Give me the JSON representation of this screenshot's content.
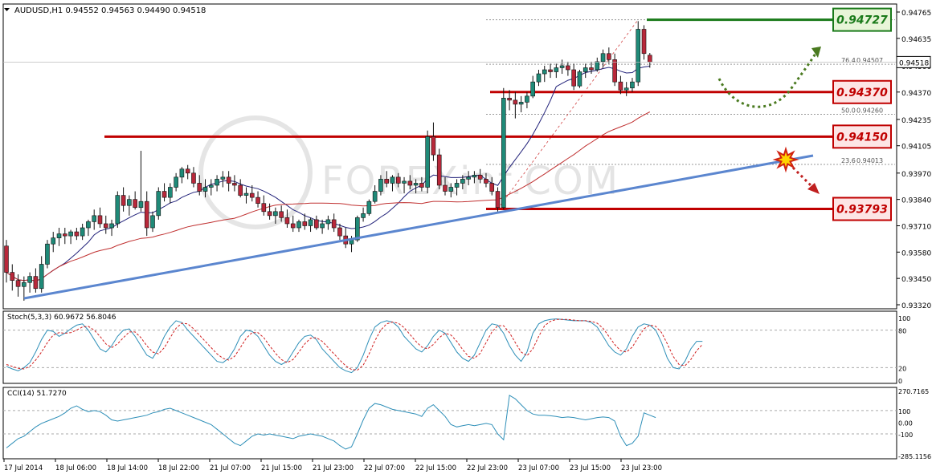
{
  "chart_data": [
    {
      "type": "candlestick",
      "symbol_header": "AUDUSD,H1  0.94552 0.94563 0.94490 0.94518",
      "y_ticks": [
        "0.94765",
        "0.94635",
        "0.94500",
        "0.94370",
        "0.94235",
        "0.94105",
        "0.93970",
        "0.93840",
        "0.93710",
        "0.93580",
        "0.93450",
        "0.93320"
      ],
      "ylim": [
        0.9332,
        0.94765
      ],
      "current_price_label": "0.94518",
      "levels": [
        {
          "label": "0.94727",
          "value": 0.94727,
          "color": "#1a7a1a"
        },
        {
          "label": "0.94370",
          "value": 0.9437,
          "color": "#c00000"
        },
        {
          "label": "0.94150",
          "value": 0.9415,
          "color": "#c00000"
        },
        {
          "label": "0.93793",
          "value": 0.93793,
          "color": "#c00000"
        }
      ],
      "fib_labels": [
        {
          "pct": "76.4",
          "price": "0.94507"
        },
        {
          "pct": "50.0",
          "price": "0.94260"
        },
        {
          "pct": "23.6",
          "price": "0.94013"
        }
      ],
      "x_labels": [
        "17 Jul 2014",
        "18 Jul 06:00",
        "18 Jul 14:00",
        "18 Jul 22:00",
        "21 Jul 07:00",
        "21 Jul 15:00",
        "21 Jul 23:00",
        "22 Jul 07:00",
        "22 Jul 15:00",
        "22 Jul 23:00",
        "23 Jul 07:00",
        "23 Jul 15:00",
        "23 Jul 23:00"
      ],
      "watermark": "FOREXinf.COM",
      "colors": {
        "bull": "#1f8a78",
        "bear": "#b8283a",
        "ma_fast": "#22227a",
        "ma_slow": "#c03030",
        "trendline": "#5b86cf"
      },
      "candles": [
        [
          0.9361,
          0.9364,
          0.9343,
          0.9348
        ],
        [
          0.9348,
          0.9352,
          0.9339,
          0.9344
        ],
        [
          0.9344,
          0.9347,
          0.9336,
          0.9341
        ],
        [
          0.9341,
          0.9346,
          0.9334,
          0.9343
        ],
        [
          0.9343,
          0.9348,
          0.9338,
          0.9346
        ],
        [
          0.9346,
          0.935,
          0.9338,
          0.934
        ],
        [
          0.934,
          0.9356,
          0.9338,
          0.9352
        ],
        [
          0.9352,
          0.9364,
          0.935,
          0.9362
        ],
        [
          0.9362,
          0.9368,
          0.9358,
          0.9365
        ],
        [
          0.9365,
          0.937,
          0.9361,
          0.9367
        ],
        [
          0.9367,
          0.937,
          0.9362,
          0.9366
        ],
        [
          0.9366,
          0.9369,
          0.9362,
          0.9368
        ],
        [
          0.9368,
          0.937,
          0.9364,
          0.9366
        ],
        [
          0.9366,
          0.9372,
          0.9364,
          0.937
        ],
        [
          0.937,
          0.9374,
          0.9366,
          0.9373
        ],
        [
          0.9373,
          0.9379,
          0.9369,
          0.9376
        ],
        [
          0.9376,
          0.938,
          0.937,
          0.9372
        ],
        [
          0.9372,
          0.9376,
          0.9367,
          0.937
        ],
        [
          0.937,
          0.9374,
          0.9366,
          0.9372
        ],
        [
          0.9372,
          0.9388,
          0.937,
          0.9386
        ],
        [
          0.9386,
          0.939,
          0.9378,
          0.9381
        ],
        [
          0.9381,
          0.9386,
          0.9376,
          0.9384
        ],
        [
          0.9384,
          0.9388,
          0.9379,
          0.938
        ],
        [
          0.938,
          0.9408,
          0.9378,
          0.9383
        ],
        [
          0.9383,
          0.9388,
          0.9366,
          0.937
        ],
        [
          0.937,
          0.9378,
          0.9368,
          0.9376
        ],
        [
          0.9376,
          0.939,
          0.9374,
          0.9388
        ],
        [
          0.9388,
          0.9392,
          0.9383,
          0.9385
        ],
        [
          0.9385,
          0.9392,
          0.9382,
          0.939
        ],
        [
          0.939,
          0.9397,
          0.9388,
          0.9395
        ],
        [
          0.9395,
          0.94,
          0.9392,
          0.9399
        ],
        [
          0.9399,
          0.9401,
          0.9394,
          0.9397
        ],
        [
          0.9397,
          0.94,
          0.939,
          0.9392
        ],
        [
          0.9392,
          0.9396,
          0.9386,
          0.9388
        ],
        [
          0.9388,
          0.9394,
          0.9385,
          0.939
        ],
        [
          0.939,
          0.9394,
          0.9386,
          0.9391
        ],
        [
          0.9391,
          0.9396,
          0.9388,
          0.9394
        ],
        [
          0.9394,
          0.9398,
          0.939,
          0.9395
        ],
        [
          0.9395,
          0.9398,
          0.9388,
          0.9392
        ],
        [
          0.9392,
          0.9396,
          0.9388,
          0.9391
        ],
        [
          0.9391,
          0.9394,
          0.9385,
          0.9386
        ],
        [
          0.9386,
          0.939,
          0.9382,
          0.9387
        ],
        [
          0.9387,
          0.9391,
          0.9383,
          0.9385
        ],
        [
          0.9385,
          0.9388,
          0.938,
          0.9382
        ],
        [
          0.9382,
          0.9386,
          0.9376,
          0.9378
        ],
        [
          0.9378,
          0.9382,
          0.9374,
          0.9376
        ],
        [
          0.9376,
          0.938,
          0.9372,
          0.9378
        ],
        [
          0.9378,
          0.9381,
          0.9373,
          0.9375
        ],
        [
          0.9375,
          0.9379,
          0.937,
          0.9372
        ],
        [
          0.9372,
          0.9376,
          0.9368,
          0.937
        ],
        [
          0.937,
          0.9374,
          0.9368,
          0.9373
        ],
        [
          0.9373,
          0.9377,
          0.9369,
          0.9371
        ],
        [
          0.9371,
          0.9375,
          0.9368,
          0.9374
        ],
        [
          0.9374,
          0.9376,
          0.9369,
          0.937
        ],
        [
          0.937,
          0.9374,
          0.9367,
          0.9372
        ],
        [
          0.9372,
          0.9376,
          0.9369,
          0.9374
        ],
        [
          0.9374,
          0.9377,
          0.9368,
          0.937
        ],
        [
          0.937,
          0.9372,
          0.9364,
          0.9366
        ],
        [
          0.9366,
          0.937,
          0.936,
          0.9362
        ],
        [
          0.9362,
          0.9366,
          0.9358,
          0.9364
        ],
        [
          0.9364,
          0.9376,
          0.9363,
          0.9375
        ],
        [
          0.9375,
          0.938,
          0.9373,
          0.9377
        ],
        [
          0.9377,
          0.9384,
          0.9376,
          0.9383
        ],
        [
          0.9383,
          0.9391,
          0.9382,
          0.9388
        ],
        [
          0.9388,
          0.9396,
          0.9386,
          0.9394
        ],
        [
          0.9394,
          0.9398,
          0.939,
          0.9392
        ],
        [
          0.9392,
          0.9396,
          0.9388,
          0.9395
        ],
        [
          0.9395,
          0.9397,
          0.939,
          0.9392
        ],
        [
          0.9392,
          0.9395,
          0.9387,
          0.9393
        ],
        [
          0.9393,
          0.9396,
          0.9389,
          0.9391
        ],
        [
          0.9391,
          0.9394,
          0.9387,
          0.9392
        ],
        [
          0.9392,
          0.9395,
          0.9388,
          0.939
        ],
        [
          0.939,
          0.9418,
          0.9387,
          0.9415
        ],
        [
          0.9415,
          0.9422,
          0.9403,
          0.9406
        ],
        [
          0.9406,
          0.9409,
          0.9389,
          0.9391
        ],
        [
          0.9391,
          0.9395,
          0.9386,
          0.9388
        ],
        [
          0.9388,
          0.9392,
          0.9385,
          0.939
        ],
        [
          0.939,
          0.9394,
          0.9386,
          0.9392
        ],
        [
          0.9392,
          0.9396,
          0.9389,
          0.9394
        ],
        [
          0.9394,
          0.9398,
          0.9391,
          0.9395
        ],
        [
          0.9395,
          0.9398,
          0.9392,
          0.9396
        ],
        [
          0.9396,
          0.9399,
          0.9392,
          0.9394
        ],
        [
          0.9394,
          0.9397,
          0.939,
          0.9392
        ],
        [
          0.9392,
          0.9395,
          0.9386,
          0.9388
        ],
        [
          0.9388,
          0.939,
          0.9378,
          0.938
        ],
        [
          0.938,
          0.9439,
          0.9379,
          0.9434
        ],
        [
          0.9434,
          0.9438,
          0.9428,
          0.9433
        ],
        [
          0.9433,
          0.9437,
          0.9424,
          0.9431
        ],
        [
          0.9431,
          0.9435,
          0.9427,
          0.9432
        ],
        [
          0.9432,
          0.9437,
          0.9429,
          0.9435
        ],
        [
          0.9435,
          0.9445,
          0.9434,
          0.9442
        ],
        [
          0.9442,
          0.9448,
          0.944,
          0.9446
        ],
        [
          0.9446,
          0.945,
          0.9442,
          0.9448
        ],
        [
          0.9448,
          0.9451,
          0.9444,
          0.9447
        ],
        [
          0.9447,
          0.9451,
          0.9444,
          0.9449
        ],
        [
          0.9449,
          0.9453,
          0.9446,
          0.945
        ],
        [
          0.945,
          0.9452,
          0.9445,
          0.9448
        ],
        [
          0.9448,
          0.9451,
          0.9438,
          0.944
        ],
        [
          0.944,
          0.9448,
          0.9439,
          0.9447
        ],
        [
          0.9447,
          0.9451,
          0.9444,
          0.9449
        ],
        [
          0.9449,
          0.9452,
          0.9446,
          0.9448
        ],
        [
          0.9448,
          0.9454,
          0.9447,
          0.9452
        ],
        [
          0.9452,
          0.9458,
          0.9449,
          0.9456
        ],
        [
          0.9456,
          0.9459,
          0.9451,
          0.9453
        ],
        [
          0.9453,
          0.9456,
          0.944,
          0.9442
        ],
        [
          0.9442,
          0.9445,
          0.9436,
          0.9438
        ],
        [
          0.9438,
          0.9442,
          0.9435,
          0.9439
        ],
        [
          0.9439,
          0.9444,
          0.9437,
          0.9442
        ],
        [
          0.9442,
          0.9472,
          0.944,
          0.9468
        ],
        [
          0.9468,
          0.947,
          0.9453,
          0.9456
        ],
        [
          0.94552,
          0.94563,
          0.9449,
          0.94518
        ]
      ],
      "stoch_header": "Stoch(5,3,3) 60.9672 56.8046",
      "stoch_ticks": [
        "100",
        "80",
        "20",
        "0"
      ],
      "stoch_main": [
        22,
        18,
        15,
        20,
        28,
        45,
        65,
        80,
        78,
        70,
        75,
        82,
        88,
        90,
        80,
        65,
        50,
        45,
        55,
        70,
        80,
        82,
        70,
        55,
        40,
        35,
        50,
        70,
        85,
        95,
        92,
        80,
        70,
        60,
        50,
        40,
        30,
        28,
        35,
        50,
        70,
        80,
        78,
        70,
        55,
        40,
        30,
        25,
        30,
        45,
        60,
        70,
        72,
        65,
        50,
        40,
        30,
        20,
        15,
        12,
        20,
        40,
        65,
        85,
        92,
        95,
        93,
        85,
        70,
        60,
        50,
        45,
        55,
        70,
        80,
        75,
        60,
        45,
        35,
        30,
        40,
        60,
        80,
        90,
        88,
        75,
        55,
        40,
        30,
        45,
        75,
        90,
        95,
        97,
        98,
        97,
        96,
        95,
        95,
        95,
        92,
        85,
        70,
        55,
        45,
        40,
        50,
        70,
        85,
        90,
        88,
        80,
        60,
        35,
        20,
        18,
        30,
        50,
        62,
        62
      ],
      "stoch_signal": [
        25,
        22,
        19,
        18,
        22,
        32,
        45,
        60,
        72,
        76,
        75,
        76,
        80,
        85,
        86,
        80,
        70,
        58,
        52,
        58,
        68,
        77,
        77,
        68,
        55,
        45,
        42,
        52,
        68,
        83,
        91,
        90,
        82,
        72,
        62,
        52,
        42,
        35,
        32,
        38,
        52,
        67,
        76,
        76,
        68,
        55,
        43,
        33,
        28,
        33,
        45,
        58,
        67,
        68,
        62,
        52,
        42,
        32,
        23,
        17,
        16,
        24,
        42,
        63,
        80,
        90,
        93,
        91,
        84,
        73,
        62,
        53,
        50,
        57,
        68,
        75,
        72,
        62,
        49,
        38,
        35,
        43,
        60,
        77,
        87,
        87,
        76,
        60,
        45,
        39,
        50,
        70,
        87,
        94,
        97,
        97,
        97,
        96,
        95,
        95,
        94,
        91,
        83,
        70,
        57,
        47,
        45,
        53,
        68,
        82,
        88,
        86,
        76,
        58,
        38,
        25,
        23,
        33,
        47,
        57
      ],
      "cci_header": "CCI(14) 51.7270",
      "cci_ticks": [
        "270.7165",
        "100",
        "0.00",
        "-100",
        "-285.1156"
      ],
      "cci_values": [
        -220,
        -180,
        -140,
        -120,
        -80,
        -40,
        -10,
        10,
        30,
        50,
        80,
        120,
        140,
        110,
        90,
        100,
        90,
        60,
        20,
        10,
        20,
        30,
        40,
        50,
        60,
        80,
        90,
        110,
        120,
        100,
        80,
        60,
        40,
        20,
        0,
        -20,
        -60,
        -100,
        -140,
        -180,
        -200,
        -160,
        -120,
        -100,
        -110,
        -100,
        -110,
        -120,
        -130,
        -140,
        -120,
        -110,
        -100,
        -110,
        -120,
        -140,
        -160,
        -200,
        -230,
        -210,
        -100,
        20,
        120,
        160,
        150,
        130,
        110,
        100,
        90,
        80,
        70,
        50,
        120,
        150,
        100,
        50,
        -20,
        -40,
        -30,
        -20,
        -30,
        -20,
        -10,
        -20,
        -100,
        -150,
        230,
        200,
        150,
        100,
        70,
        60,
        60,
        55,
        50,
        40,
        45,
        40,
        30,
        20,
        30,
        40,
        45,
        40,
        10,
        -120,
        -200,
        -180,
        -120,
        80,
        60,
        40
      ]
    }
  ]
}
